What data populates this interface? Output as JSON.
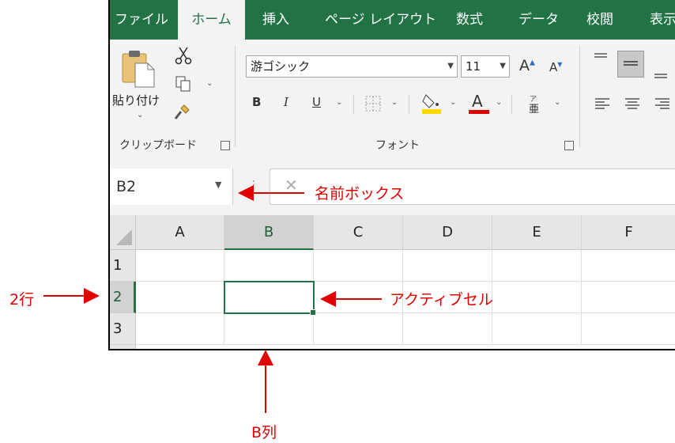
{
  "ribbon": {
    "tabs": [
      "ファイル",
      "ホーム",
      "挿入",
      "ページ レイアウト",
      "数式",
      "データ",
      "校閲",
      "表示"
    ],
    "active_tab": "ホーム",
    "clipboard": {
      "paste_label": "貼り付け",
      "group_label": "クリップボード"
    },
    "font": {
      "font_name": "游ゴシック",
      "font_size": "11",
      "group_label": "フォント",
      "bold": "B",
      "italic": "I",
      "underline": "U",
      "font_color_letter": "A"
    }
  },
  "name_box": {
    "value": "B2"
  },
  "grid": {
    "columns": [
      "A",
      "B",
      "C",
      "D",
      "E",
      "F"
    ],
    "rows": [
      "1",
      "2",
      "3"
    ],
    "active_cell": "B2"
  },
  "annotations": {
    "name_box": "名前ボックス",
    "active_cell": "アクティブセル",
    "row": "2行",
    "column": "B列"
  },
  "colors": {
    "accent": "#217346",
    "annotation": "#e00000",
    "highlight_yellow": "#ffd800",
    "font_red": "#e00000"
  }
}
